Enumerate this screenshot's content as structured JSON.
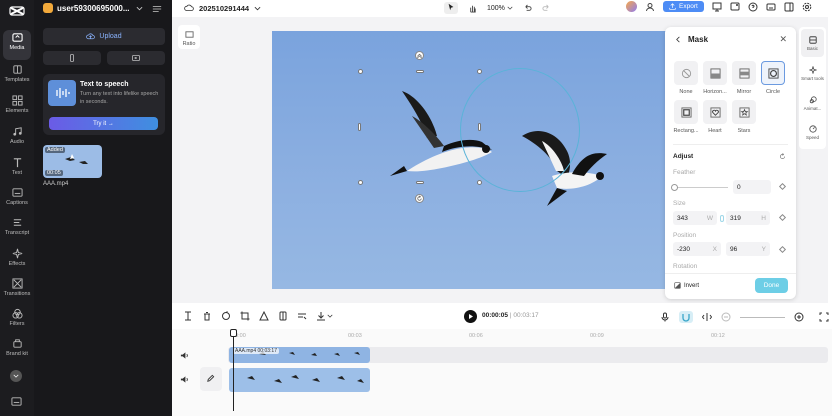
{
  "sidebar": {
    "items": [
      {
        "label": "Media",
        "icon": "media-icon",
        "active": true
      },
      {
        "label": "Templates",
        "icon": "templates-icon"
      },
      {
        "label": "Elements",
        "icon": "elements-icon"
      },
      {
        "label": "Audio",
        "icon": "audio-icon"
      },
      {
        "label": "Text",
        "icon": "text-icon"
      },
      {
        "label": "Captions",
        "icon": "captions-icon"
      },
      {
        "label": "Transcript",
        "icon": "transcript-icon"
      },
      {
        "label": "Effects",
        "icon": "effects-icon"
      },
      {
        "label": "Transitions",
        "icon": "transitions-icon"
      },
      {
        "label": "Filters",
        "icon": "filters-icon"
      },
      {
        "label": "Brand kit",
        "icon": "brand-kit-icon"
      }
    ]
  },
  "panel": {
    "username": "user59300695000...",
    "upload_label": "Upload",
    "tts": {
      "title": "Text to speech",
      "desc": "Turn any text into lifelike speech in seconds.",
      "button": "Try it →"
    },
    "media": {
      "badge": "Added",
      "duration": "00:05",
      "name": "AAA.mp4"
    }
  },
  "topbar": {
    "project_name": "202510291444",
    "zoom": "100%",
    "export_label": "Export"
  },
  "canvas": {
    "ratio_label": "Ratio"
  },
  "mask_panel": {
    "title": "Mask",
    "shapes": [
      {
        "label": "None"
      },
      {
        "label": "Horizon..."
      },
      {
        "label": "Mirror"
      },
      {
        "label": "Circle",
        "selected": true
      },
      {
        "label": "Rectang..."
      },
      {
        "label": "Heart"
      },
      {
        "label": "Stars"
      }
    ],
    "adjust_label": "Adjust",
    "feather_label": "Feather",
    "feather_value": "0",
    "size_label": "Size",
    "size_w": "343",
    "size_w_unit": "W",
    "size_h": "319",
    "size_h_unit": "H",
    "position_label": "Position",
    "position_x": "-230",
    "position_x_unit": "X",
    "position_y": "96",
    "position_y_unit": "Y",
    "rotation_label": "Rotation",
    "invert_label": "Invert",
    "done_label": "Done"
  },
  "right_tabs": [
    {
      "label": "Basic",
      "active": true
    },
    {
      "label": "Smart tools"
    },
    {
      "label": "Animat..."
    },
    {
      "label": "Speed"
    }
  ],
  "timeline": {
    "current_time": "00:00:05",
    "total_time": "00:03:17",
    "ruler": [
      "00:00",
      "00:03",
      "00:06",
      "00:09",
      "00:12"
    ],
    "clip_label": "AAA.mp4",
    "clip_duration": "00:03:17"
  },
  "colors": {
    "accent": "#4d8cf5",
    "done": "#6dcee6",
    "mask_outline": "#5ab3d8"
  }
}
